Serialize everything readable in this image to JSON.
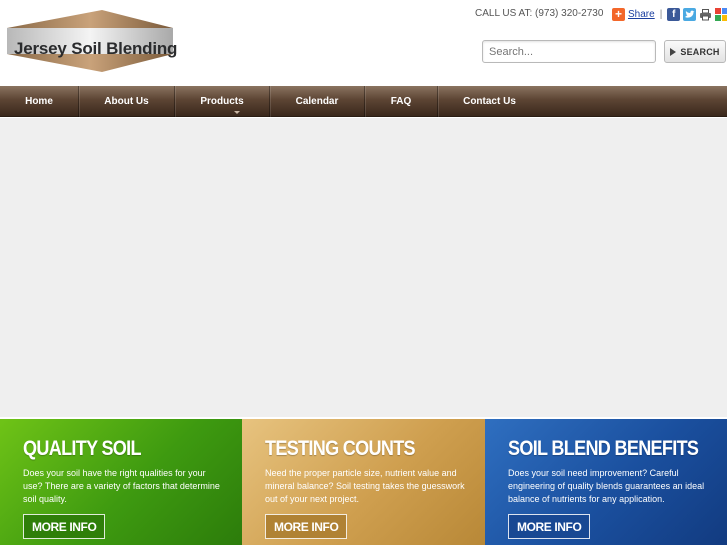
{
  "header": {
    "logo_text": "Jersey Soil Blending",
    "call_us": "CALL US AT: (973) 320-2730",
    "share_label": "Share",
    "share_separator": "|",
    "search_placeholder": "Search...",
    "search_button": "SEARCH"
  },
  "nav": {
    "items": [
      {
        "label": "Home"
      },
      {
        "label": "About Us"
      },
      {
        "label": "Products"
      },
      {
        "label": "Calendar"
      },
      {
        "label": "FAQ"
      },
      {
        "label": "Contact Us"
      }
    ]
  },
  "promos": [
    {
      "title": "QUALITY SOIL",
      "text": "Does your soil have the right qualities for your use? There are a variety of factors that determine soil quality.",
      "button": "MORE INFO",
      "color": "#4aa614"
    },
    {
      "title": "TESTING COUNTS",
      "text": "Need the proper particle size, nutrient value and mineral balance? Soil testing takes the guesswork out of your next project.",
      "button": "MORE INFO",
      "color": "#d6a95a"
    },
    {
      "title": "SOIL BLEND BENEFITS",
      "text": "Does your soil need improvement? Careful engineering of quality blends guarantees an ideal balance of nutrients for any application.",
      "button": "MORE INFO",
      "color": "#1d56a6"
    }
  ],
  "icons": {
    "share": "share-plus-icon",
    "facebook": "facebook-icon",
    "twitter": "twitter-icon",
    "print": "print-icon",
    "google": "google-bookmark-icon",
    "search_button": "play-arrow-icon"
  }
}
